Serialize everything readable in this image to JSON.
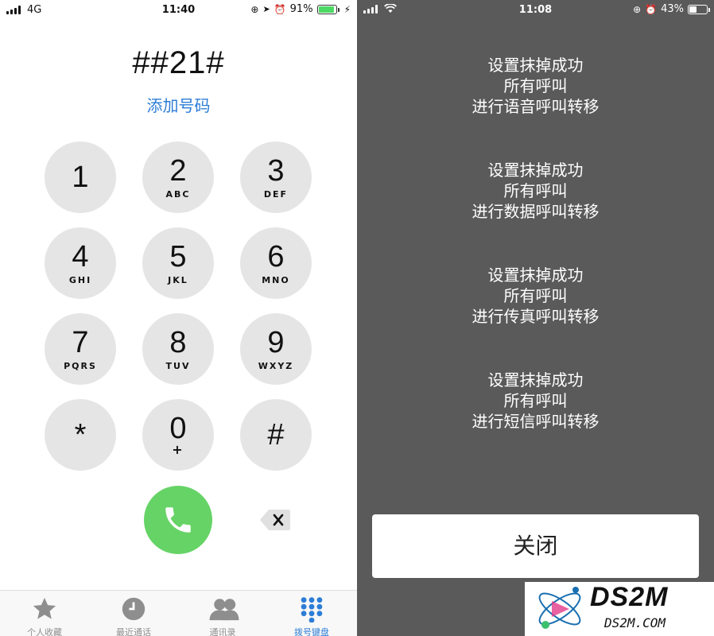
{
  "left": {
    "status": {
      "carrier": "4G",
      "time": "11:40",
      "battery": "91%",
      "battery_level": 0.91,
      "battery_color": "#4cd964"
    },
    "dialed_number": "##21#",
    "add_number_link": "添加号码",
    "keys": [
      {
        "digit": "1",
        "letters": ""
      },
      {
        "digit": "2",
        "letters": "ABC"
      },
      {
        "digit": "3",
        "letters": "DEF"
      },
      {
        "digit": "4",
        "letters": "GHI"
      },
      {
        "digit": "5",
        "letters": "JKL"
      },
      {
        "digit": "6",
        "letters": "MNO"
      },
      {
        "digit": "7",
        "letters": "PQRS"
      },
      {
        "digit": "8",
        "letters": "TUV"
      },
      {
        "digit": "9",
        "letters": "WXYZ"
      },
      {
        "digit": "*",
        "letters": ""
      },
      {
        "digit": "0",
        "letters": "+"
      },
      {
        "digit": "#",
        "letters": ""
      }
    ],
    "tabs": [
      {
        "label": "个人收藏",
        "icon": "star-icon"
      },
      {
        "label": "最近通话",
        "icon": "clock-icon"
      },
      {
        "label": "通讯录",
        "icon": "contacts-icon"
      },
      {
        "label": "拨号键盘",
        "icon": "keypad-icon",
        "active": true
      }
    ],
    "accent_color": "#2c7dd6",
    "call_color": "#66d366"
  },
  "right": {
    "status": {
      "time": "11:08",
      "battery": "43%",
      "battery_level": 0.43
    },
    "messages": [
      {
        "line1": "设置抹掉成功",
        "line2": "所有呼叫",
        "line3": "进行语音呼叫转移"
      },
      {
        "line1": "设置抹掉成功",
        "line2": "所有呼叫",
        "line3": "进行数据呼叫转移"
      },
      {
        "line1": "设置抹掉成功",
        "line2": "所有呼叫",
        "line3": "进行传真呼叫转移"
      },
      {
        "line1": "设置抹掉成功",
        "line2": "所有呼叫",
        "line3": "进行短信呼叫转移"
      }
    ],
    "close_button": "关闭"
  },
  "watermark": {
    "main": "DS2M",
    "sub": "DS2M.COM"
  }
}
